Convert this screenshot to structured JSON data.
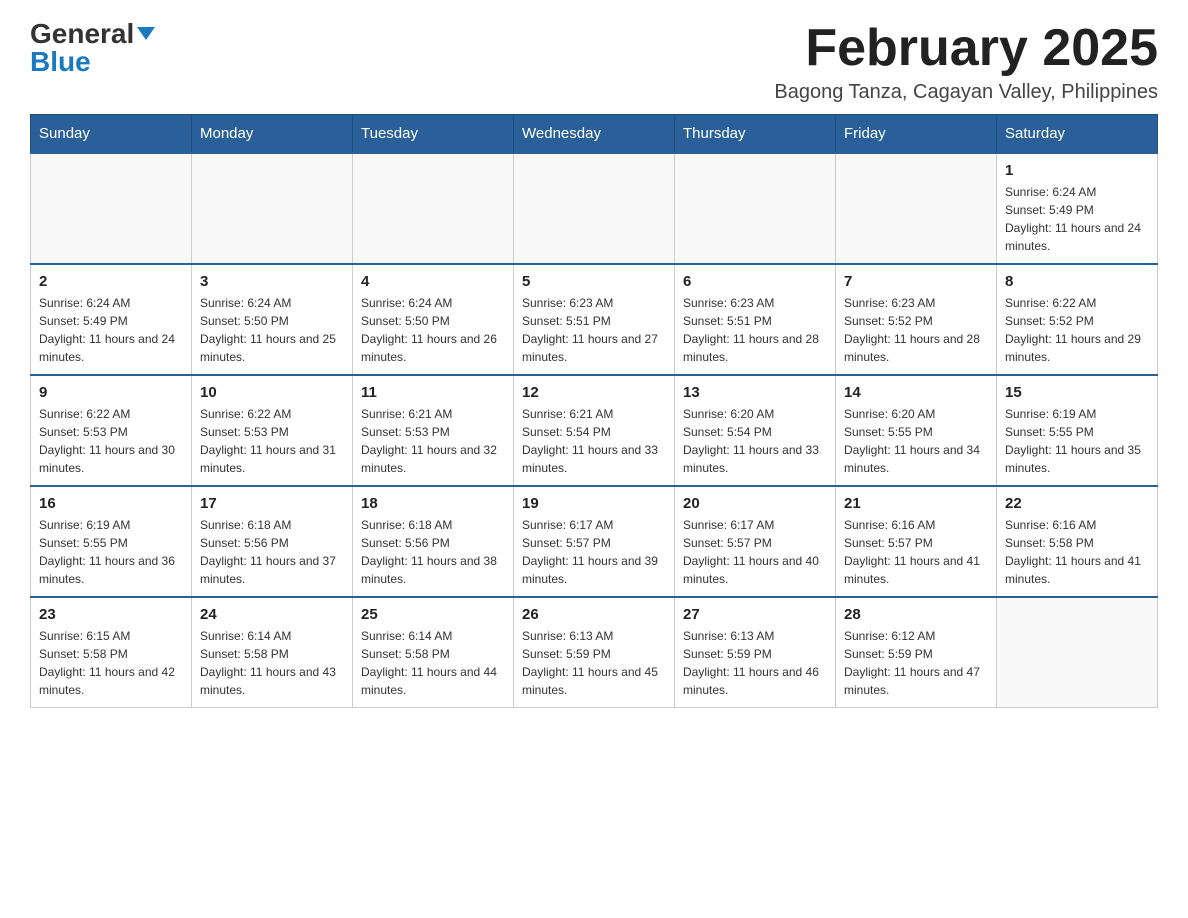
{
  "header": {
    "logo_general": "General",
    "logo_blue": "Blue",
    "month_title": "February 2025",
    "location": "Bagong Tanza, Cagayan Valley, Philippines"
  },
  "days_of_week": [
    "Sunday",
    "Monday",
    "Tuesday",
    "Wednesday",
    "Thursday",
    "Friday",
    "Saturday"
  ],
  "weeks": [
    [
      {
        "day": "",
        "info": ""
      },
      {
        "day": "",
        "info": ""
      },
      {
        "day": "",
        "info": ""
      },
      {
        "day": "",
        "info": ""
      },
      {
        "day": "",
        "info": ""
      },
      {
        "day": "",
        "info": ""
      },
      {
        "day": "1",
        "info": "Sunrise: 6:24 AM\nSunset: 5:49 PM\nDaylight: 11 hours and 24 minutes."
      }
    ],
    [
      {
        "day": "2",
        "info": "Sunrise: 6:24 AM\nSunset: 5:49 PM\nDaylight: 11 hours and 24 minutes."
      },
      {
        "day": "3",
        "info": "Sunrise: 6:24 AM\nSunset: 5:50 PM\nDaylight: 11 hours and 25 minutes."
      },
      {
        "day": "4",
        "info": "Sunrise: 6:24 AM\nSunset: 5:50 PM\nDaylight: 11 hours and 26 minutes."
      },
      {
        "day": "5",
        "info": "Sunrise: 6:23 AM\nSunset: 5:51 PM\nDaylight: 11 hours and 27 minutes."
      },
      {
        "day": "6",
        "info": "Sunrise: 6:23 AM\nSunset: 5:51 PM\nDaylight: 11 hours and 28 minutes."
      },
      {
        "day": "7",
        "info": "Sunrise: 6:23 AM\nSunset: 5:52 PM\nDaylight: 11 hours and 28 minutes."
      },
      {
        "day": "8",
        "info": "Sunrise: 6:22 AM\nSunset: 5:52 PM\nDaylight: 11 hours and 29 minutes."
      }
    ],
    [
      {
        "day": "9",
        "info": "Sunrise: 6:22 AM\nSunset: 5:53 PM\nDaylight: 11 hours and 30 minutes."
      },
      {
        "day": "10",
        "info": "Sunrise: 6:22 AM\nSunset: 5:53 PM\nDaylight: 11 hours and 31 minutes."
      },
      {
        "day": "11",
        "info": "Sunrise: 6:21 AM\nSunset: 5:53 PM\nDaylight: 11 hours and 32 minutes."
      },
      {
        "day": "12",
        "info": "Sunrise: 6:21 AM\nSunset: 5:54 PM\nDaylight: 11 hours and 33 minutes."
      },
      {
        "day": "13",
        "info": "Sunrise: 6:20 AM\nSunset: 5:54 PM\nDaylight: 11 hours and 33 minutes."
      },
      {
        "day": "14",
        "info": "Sunrise: 6:20 AM\nSunset: 5:55 PM\nDaylight: 11 hours and 34 minutes."
      },
      {
        "day": "15",
        "info": "Sunrise: 6:19 AM\nSunset: 5:55 PM\nDaylight: 11 hours and 35 minutes."
      }
    ],
    [
      {
        "day": "16",
        "info": "Sunrise: 6:19 AM\nSunset: 5:55 PM\nDaylight: 11 hours and 36 minutes."
      },
      {
        "day": "17",
        "info": "Sunrise: 6:18 AM\nSunset: 5:56 PM\nDaylight: 11 hours and 37 minutes."
      },
      {
        "day": "18",
        "info": "Sunrise: 6:18 AM\nSunset: 5:56 PM\nDaylight: 11 hours and 38 minutes."
      },
      {
        "day": "19",
        "info": "Sunrise: 6:17 AM\nSunset: 5:57 PM\nDaylight: 11 hours and 39 minutes."
      },
      {
        "day": "20",
        "info": "Sunrise: 6:17 AM\nSunset: 5:57 PM\nDaylight: 11 hours and 40 minutes."
      },
      {
        "day": "21",
        "info": "Sunrise: 6:16 AM\nSunset: 5:57 PM\nDaylight: 11 hours and 41 minutes."
      },
      {
        "day": "22",
        "info": "Sunrise: 6:16 AM\nSunset: 5:58 PM\nDaylight: 11 hours and 41 minutes."
      }
    ],
    [
      {
        "day": "23",
        "info": "Sunrise: 6:15 AM\nSunset: 5:58 PM\nDaylight: 11 hours and 42 minutes."
      },
      {
        "day": "24",
        "info": "Sunrise: 6:14 AM\nSunset: 5:58 PM\nDaylight: 11 hours and 43 minutes."
      },
      {
        "day": "25",
        "info": "Sunrise: 6:14 AM\nSunset: 5:58 PM\nDaylight: 11 hours and 44 minutes."
      },
      {
        "day": "26",
        "info": "Sunrise: 6:13 AM\nSunset: 5:59 PM\nDaylight: 11 hours and 45 minutes."
      },
      {
        "day": "27",
        "info": "Sunrise: 6:13 AM\nSunset: 5:59 PM\nDaylight: 11 hours and 46 minutes."
      },
      {
        "day": "28",
        "info": "Sunrise: 6:12 AM\nSunset: 5:59 PM\nDaylight: 11 hours and 47 minutes."
      },
      {
        "day": "",
        "info": ""
      }
    ]
  ]
}
